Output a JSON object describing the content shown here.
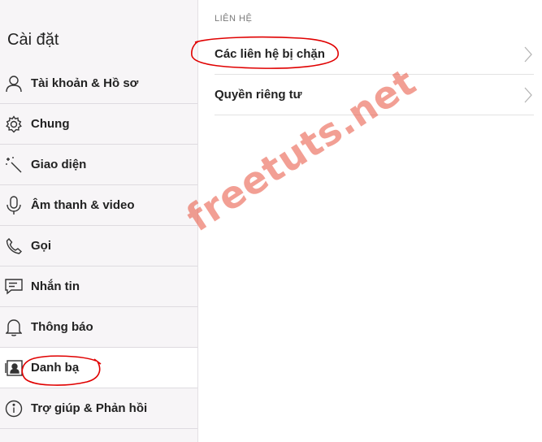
{
  "sidebar": {
    "title": "Cài đặt",
    "items": [
      {
        "label": "Tài khoản & Hồ sơ",
        "icon": "person-icon"
      },
      {
        "label": "Chung",
        "icon": "gear-icon"
      },
      {
        "label": "Giao diện",
        "icon": "magic-wand-icon"
      },
      {
        "label": "Âm thanh & video",
        "icon": "microphone-icon"
      },
      {
        "label": "Gọi",
        "icon": "phone-icon"
      },
      {
        "label": "Nhắn tin",
        "icon": "chat-icon"
      },
      {
        "label": "Thông báo",
        "icon": "bell-icon"
      },
      {
        "label": "Danh bạ",
        "icon": "contacts-icon",
        "active": true
      },
      {
        "label": "Trợ giúp & Phản hồi",
        "icon": "info-icon"
      }
    ]
  },
  "main": {
    "section_header": "LIÊN HỆ",
    "rows": [
      {
        "label": "Các liên hệ bị chặn",
        "icon": "chevron-right-icon"
      },
      {
        "label": "Quyền riêng tư",
        "icon": "chevron-right-icon"
      }
    ]
  },
  "watermark": "freetuts.net",
  "colors": {
    "annotation": "#e00000",
    "watermark": "#e8503c",
    "sidebar_bg": "#f7f5f7"
  }
}
